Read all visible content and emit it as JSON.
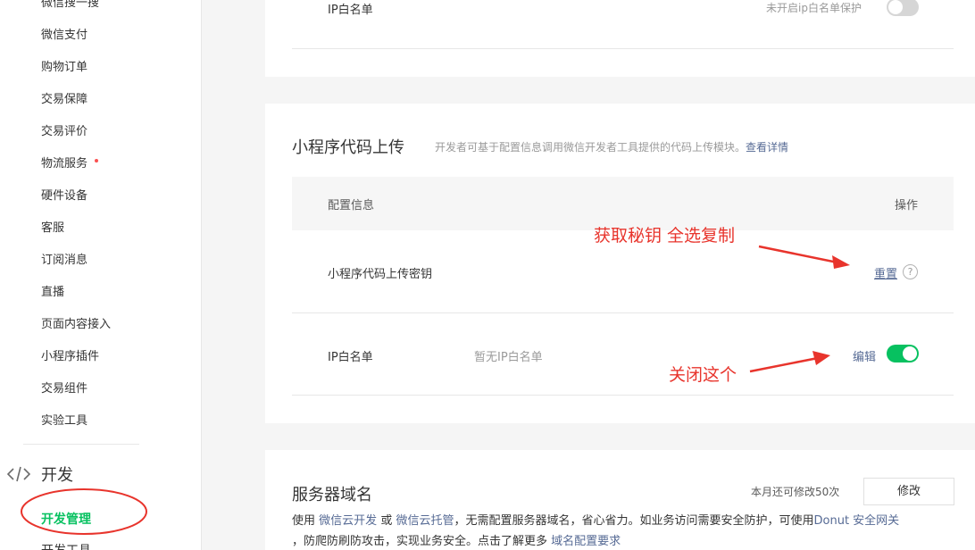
{
  "sidebar": {
    "items": [
      {
        "label": "微信搜一搜"
      },
      {
        "label": "微信支付"
      },
      {
        "label": "购物订单"
      },
      {
        "label": "交易保障"
      },
      {
        "label": "交易评价"
      },
      {
        "label": "物流服务"
      },
      {
        "label": "硬件设备"
      },
      {
        "label": "客服"
      },
      {
        "label": "订阅消息"
      },
      {
        "label": "直播"
      },
      {
        "label": "页面内容接入"
      },
      {
        "label": "小程序插件"
      },
      {
        "label": "交易组件"
      },
      {
        "label": "实验工具"
      }
    ],
    "section_label": "开发",
    "dev_manage": "开发管理",
    "dev_tools": "开发工具"
  },
  "ip_card_top": {
    "label": "IP白名单",
    "status": "未开启ip白名单保护"
  },
  "upload_card": {
    "title": "小程序代码上传",
    "desc": "开发者可基于配置信息调用微信开发者工具提供的代码上传模块。",
    "desc_link": "查看详情",
    "table_head": {
      "col1": "配置信息",
      "col2": "操作"
    },
    "rows": [
      {
        "label": "小程序代码上传密钥",
        "action": "重置",
        "help": "?"
      },
      {
        "label": "IP白名单",
        "value": "暂无IP白名单",
        "action": "编辑"
      }
    ]
  },
  "server_card": {
    "title": "服务器域名",
    "quota": "本月还可修改50次",
    "modify_btn": "修改",
    "line1_a": "使用",
    "line1_link1": "微信云开发",
    "line1_b": "或",
    "line1_link2": "微信云托管",
    "line1_c": "，无需配置服务器域名，省心省力。如业务访问需要安全防护，可使用",
    "line1_link3": "Donut 安全网关",
    "line2_a": "，防爬防刷防攻击，实现业务安全。点击了解更多",
    "line2_link": "域名配置要求"
  },
  "annotations": {
    "note1": "获取秘钥 全选复制",
    "note2": "关闭这个"
  },
  "colors": {
    "accent_green": "#07c160",
    "link_blue": "#576b95",
    "annotation_red": "#e8342c"
  }
}
